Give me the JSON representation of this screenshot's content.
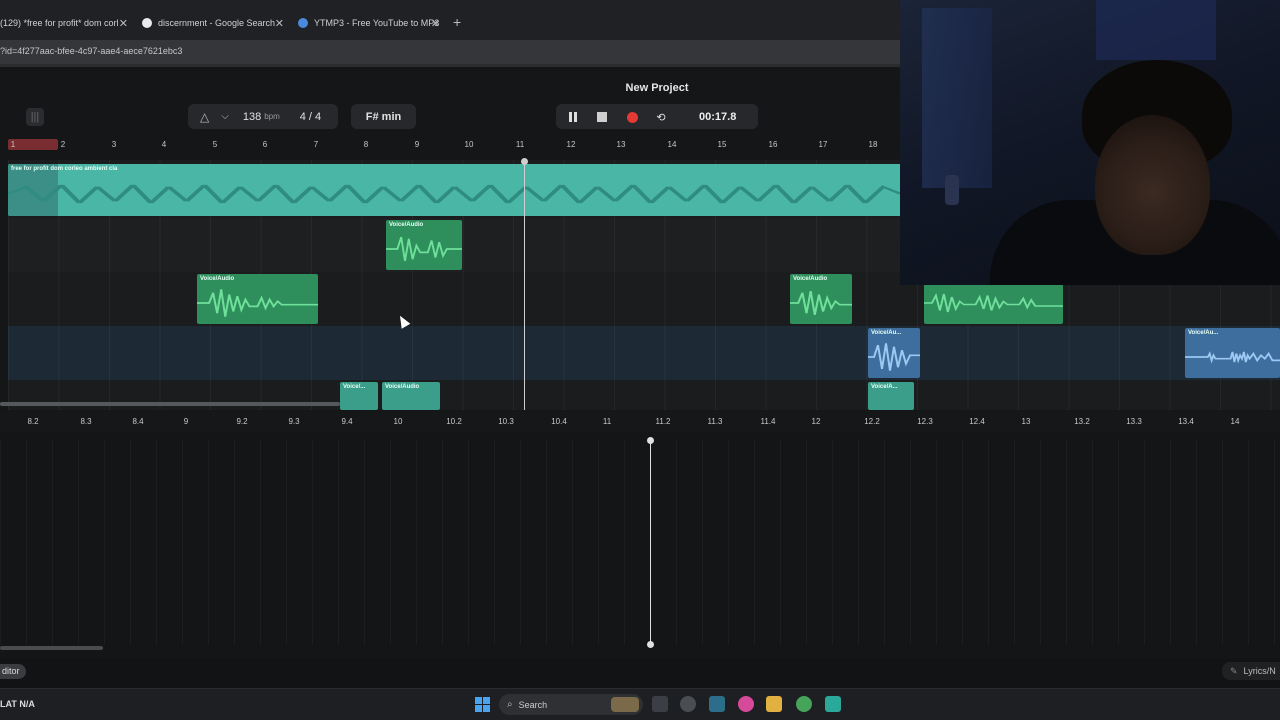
{
  "browser": {
    "tabs": [
      {
        "label": "(129) *free for profit* dom corl"
      },
      {
        "label": "discernment - Google Search"
      },
      {
        "label": "YTMP3 - Free YouTube to MP3"
      }
    ],
    "close_glyph": "✕",
    "new_tab_glyph": "+",
    "address": "?id=4f277aac-bfee-4c97-aae4-aece7621ebc3"
  },
  "project": {
    "title": "New Project",
    "bpm": "138",
    "bpm_unit": "bpm",
    "time_signature": "4 / 4",
    "key": "F# min",
    "time": "00:17.8",
    "metronome_icon": "metronome-icon",
    "chevron_glyph": "⌵"
  },
  "ruler_top": [
    "1",
    "2",
    "3",
    "4",
    "5",
    "6",
    "7",
    "8",
    "9",
    "10",
    "11",
    "12",
    "13",
    "14",
    "15",
    "16",
    "17",
    "18"
  ],
  "clips": {
    "main": "free for profit dom corleo  ambient  cla",
    "voice": "Voice/Audio",
    "voice_short": "Voice/Au...",
    "voice_short2": "Voice/A...",
    "voice_tiny": "Voice/..."
  },
  "ruler_bottom": [
    "8.2",
    "8.3",
    "8.4",
    "9",
    "9.2",
    "9.3",
    "9.4",
    "10",
    "10.2",
    "10.3",
    "10.4",
    "11",
    "11.2",
    "11.3",
    "11.4",
    "12",
    "12.2",
    "12.3",
    "12.4",
    "13",
    "13.2",
    "13.3",
    "13.4",
    "14"
  ],
  "footer": {
    "editor_tab": "ditor",
    "lyrics_tab": "Lyrics/N"
  },
  "taskbar": {
    "weather": "LAT  N/A",
    "search": "Search"
  },
  "colors": {
    "main_clip": "#4ab6a5",
    "voice_clip": "#2e8e5c",
    "blue_clip": "#3d6e9e",
    "record": "#e53935",
    "loop_marker": "#7a2d30"
  }
}
